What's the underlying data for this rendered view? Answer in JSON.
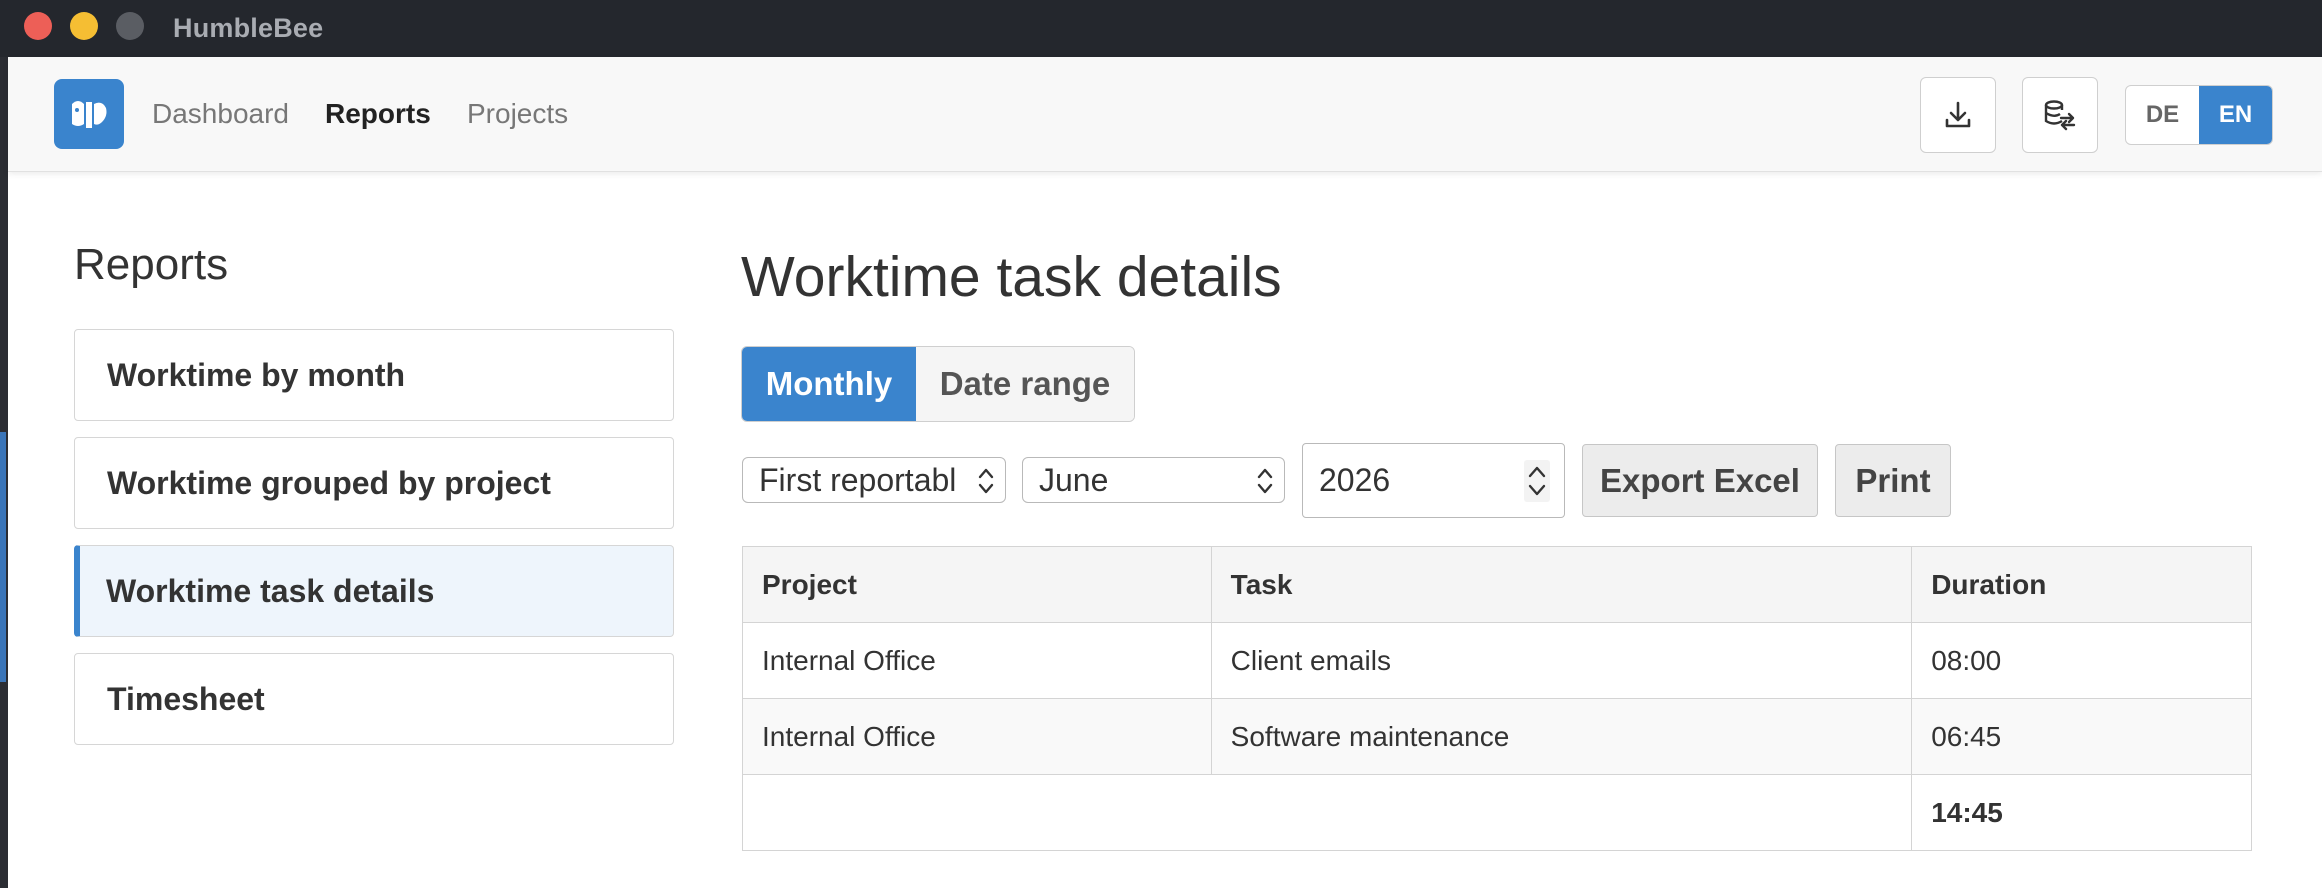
{
  "window": {
    "title": "HumbleBee"
  },
  "nav": {
    "links": [
      {
        "label": "Dashboard"
      },
      {
        "label": "Reports"
      },
      {
        "label": "Projects"
      }
    ],
    "languages": [
      "DE",
      "EN"
    ],
    "active_language": "EN",
    "icons": [
      "download-icon",
      "database-sync-icon"
    ]
  },
  "sidebar": {
    "title": "Reports",
    "items": [
      {
        "label": "Worktime by month"
      },
      {
        "label": "Worktime grouped by project"
      },
      {
        "label": "Worktime task details"
      },
      {
        "label": "Timesheet"
      }
    ],
    "active_item": "Worktime task details"
  },
  "main": {
    "title": "Worktime task details",
    "modes": [
      {
        "label": "Monthly"
      },
      {
        "label": "Date range"
      }
    ],
    "active_mode": "Monthly",
    "filters": {
      "day_select": "First reportabl",
      "month_select": "June",
      "year": "2026"
    },
    "actions": {
      "export_label": "Export Excel",
      "print_label": "Print"
    },
    "table": {
      "columns": [
        "Project",
        "Task",
        "Duration"
      ],
      "rows": [
        {
          "project": "Internal Office",
          "task": "Client emails",
          "duration": "08:00"
        },
        {
          "project": "Internal Office",
          "task": "Software maintenance",
          "duration": "06:45"
        }
      ],
      "total": "14:45"
    }
  },
  "colors": {
    "accent": "#3a84cd",
    "titlebar": "#24272d",
    "close": "#ed5f57",
    "minimize": "#f5be33"
  }
}
